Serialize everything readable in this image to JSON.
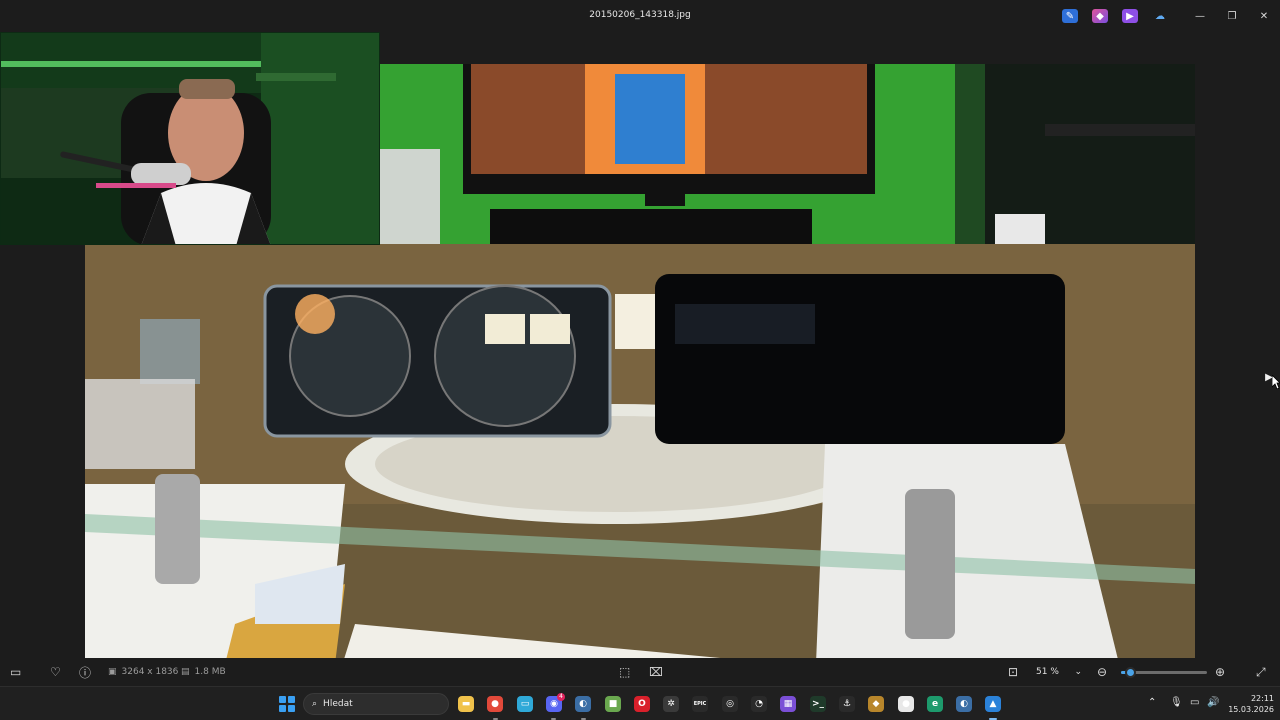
{
  "window": {
    "title": "20150206_143318.jpg",
    "header_icons": [
      "edit-icon",
      "copilot-icon",
      "video-editor-icon",
      "cloud-icon"
    ],
    "controls": [
      "minimize-icon",
      "maximize-icon",
      "close-icon"
    ]
  },
  "viewer": {
    "next_icon": "▶"
  },
  "toolbar": {
    "dimensions": "3264 x 1836",
    "file_size": "1.8 MB",
    "zoom": "51 %",
    "zoom_fraction": 0.1
  },
  "taskbar": {
    "search_placeholder": "Hledat",
    "badge_count": "4",
    "apps": [
      {
        "name": "file-explorer",
        "glyph": "▬",
        "color": "#f0c24b"
      },
      {
        "name": "chrome",
        "glyph": "●",
        "color": "#e2493a"
      },
      {
        "name": "display",
        "glyph": "▭",
        "color": "#2fa9d8"
      },
      {
        "name": "discord",
        "glyph": "◉",
        "color": "#5865f2"
      },
      {
        "name": "steam",
        "glyph": "◐",
        "color": "#3b6ea5"
      },
      {
        "name": "minecraft",
        "glyph": "■",
        "color": "#6aa84f"
      },
      {
        "name": "opera",
        "glyph": "O",
        "color": "#d9202b"
      },
      {
        "name": "chatgpt",
        "glyph": "✲",
        "color": "#3a3a3a"
      },
      {
        "name": "epic-games",
        "glyph": "EPIC",
        "color": "#2a2a2a"
      },
      {
        "name": "obs",
        "glyph": "◎",
        "color": "#2a2a2a"
      },
      {
        "name": "recorder",
        "glyph": "◔",
        "color": "#2a2a2a"
      },
      {
        "name": "grid-app",
        "glyph": "▦",
        "color": "#7b4fd6"
      },
      {
        "name": "terminal",
        "glyph": ">_",
        "color": "#1f3a2a"
      },
      {
        "name": "anchor-app",
        "glyph": "⚓",
        "color": "#2a2a2a"
      },
      {
        "name": "game-app",
        "glyph": "◆",
        "color": "#b8862b"
      },
      {
        "name": "circle-app",
        "glyph": "●",
        "color": "#e8e8e8"
      },
      {
        "name": "edge",
        "glyph": "e",
        "color": "#1d9a6c"
      },
      {
        "name": "steam-2",
        "glyph": "◐",
        "color": "#3b6ea5"
      },
      {
        "name": "photos",
        "glyph": "▲",
        "color": "#2b82d9"
      }
    ],
    "clock_time": "22:11",
    "clock_date": "15.03.2026"
  }
}
